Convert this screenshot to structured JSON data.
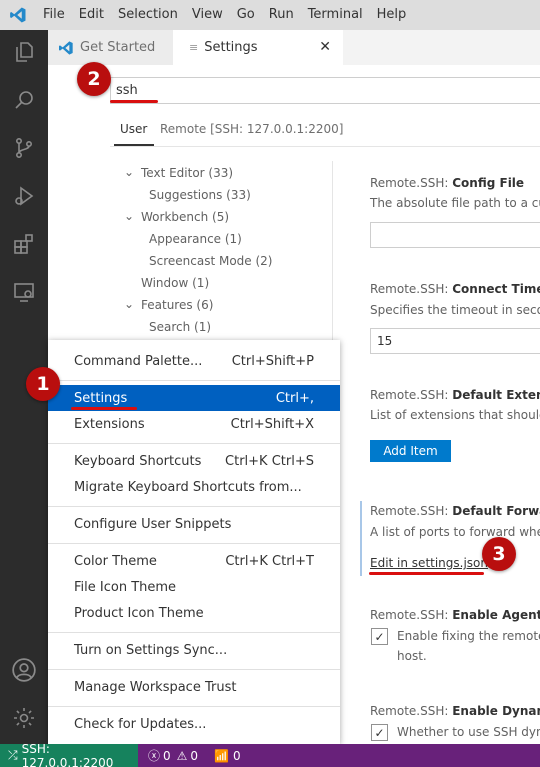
{
  "menubar": [
    "File",
    "Edit",
    "Selection",
    "View",
    "Go",
    "Run",
    "Terminal",
    "Help"
  ],
  "tabs": [
    {
      "label": "Get Started"
    },
    {
      "label": "Settings",
      "close": "✕"
    }
  ],
  "search": {
    "value": "ssh"
  },
  "scope_tabs": {
    "user": "User",
    "remote": "Remote [SSH: 127.0.0.1:2200]"
  },
  "toc": [
    {
      "label": "Text Editor (33)",
      "chevron": "⌄"
    },
    {
      "label": "Suggestions (33)"
    },
    {
      "label": "Workbench (5)",
      "chevron": "⌄"
    },
    {
      "label": "Appearance (1)"
    },
    {
      "label": "Screencast Mode (2)"
    },
    {
      "label": "Window (1)"
    },
    {
      "label": "Features (6)",
      "chevron": "⌄"
    },
    {
      "label": "Search (1)"
    }
  ],
  "settings": {
    "config_file": {
      "prefix": "Remote.SSH: ",
      "name": "Config File",
      "desc": "The absolute file path to a cus"
    },
    "connect_timeout": {
      "prefix": "Remote.SSH: ",
      "name": "Connect Timeou",
      "desc": "Specifies the timeout in secon",
      "value": "15"
    },
    "default_extensions": {
      "prefix": "Remote.SSH: ",
      "name": "Default Extensio",
      "desc": "List of extensions that should",
      "button": "Add Item"
    },
    "default_forward": {
      "prefix": "Remote.SSH: ",
      "name": "Default Forward",
      "desc": "A list of ports to forward wher",
      "link": "Edit in settings.json"
    },
    "agent_forwarding": {
      "prefix": "Remote.SSH: ",
      "name": "Enable Agent Fo",
      "desc1": "Enable fixing the remote",
      "desc2": "host."
    },
    "dynamic_forwarding": {
      "prefix": "Remote.SSH: ",
      "name": "Enable Dynamic",
      "desc1": "Whether to use SSH dyna"
    }
  },
  "context_menu": {
    "groups": [
      [
        {
          "label": "Command Palette...",
          "shortcut": "Ctrl+Shift+P"
        }
      ],
      [
        {
          "label": "Settings",
          "shortcut": "Ctrl+,",
          "selected": true
        },
        {
          "label": "Extensions",
          "shortcut": "Ctrl+Shift+X"
        }
      ],
      [
        {
          "label": "Keyboard Shortcuts",
          "shortcut": "Ctrl+K Ctrl+S"
        },
        {
          "label": "Migrate Keyboard Shortcuts from...",
          "shortcut": ""
        }
      ],
      [
        {
          "label": "Configure User Snippets",
          "shortcut": ""
        }
      ],
      [
        {
          "label": "Color Theme",
          "shortcut": "Ctrl+K Ctrl+T"
        },
        {
          "label": "File Icon Theme",
          "shortcut": ""
        },
        {
          "label": "Product Icon Theme",
          "shortcut": ""
        }
      ],
      [
        {
          "label": "Turn on Settings Sync...",
          "shortcut": ""
        }
      ],
      [
        {
          "label": "Manage Workspace Trust",
          "shortcut": ""
        }
      ],
      [
        {
          "label": "Check for Updates...",
          "shortcut": ""
        }
      ]
    ]
  },
  "annotations": {
    "step1": "1",
    "step2": "2",
    "step3": "3"
  },
  "statusbar": {
    "remote": "SSH: 127.0.0.1:2200",
    "errors": "0",
    "warnings": "0",
    "ports": "0"
  },
  "colors": {
    "activity_bar": "#2c2c2c",
    "status_bar": "#68217a",
    "remote_indicator": "#16825d",
    "menu_selection": "#0060c0",
    "accent": "#007acc",
    "annotation": "#b90e0e"
  }
}
